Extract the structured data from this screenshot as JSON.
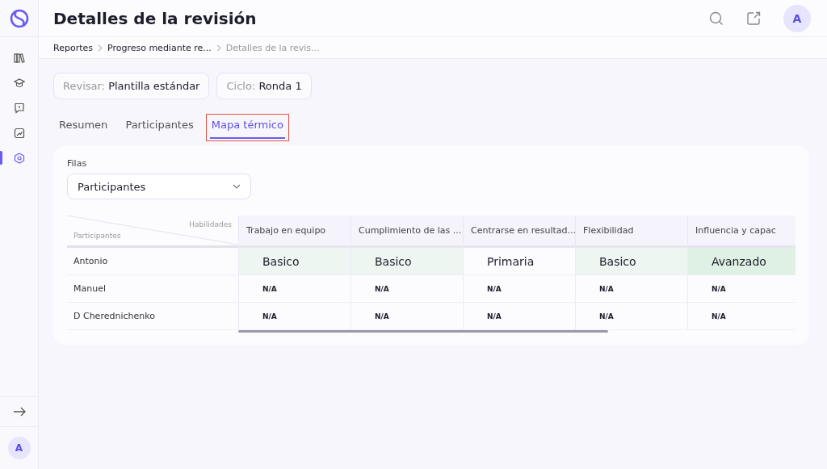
{
  "sidebar": {
    "items": [
      {
        "selected": false
      },
      {
        "selected": false
      },
      {
        "selected": false
      },
      {
        "selected": false
      },
      {
        "selected": true
      }
    ],
    "user_avatar": "A"
  },
  "header": {
    "title": "Detalles de la revisión",
    "avatar": "A"
  },
  "breadcrumb": [
    {
      "label": "Reportes",
      "current": false
    },
    {
      "label": "Progreso mediante re...",
      "current": false
    },
    {
      "label": "Detalles de la revis...",
      "current": true
    }
  ],
  "filters": [
    {
      "label": "Revisar:",
      "value": "Plantilla estándar"
    },
    {
      "label": "Ciclo:",
      "value": "Ronda 1"
    }
  ],
  "tabs": [
    {
      "label": "Resumen",
      "selected": false,
      "highlighted": false
    },
    {
      "label": "Participantes",
      "selected": false,
      "highlighted": false
    },
    {
      "label": "Mapa térmico",
      "selected": true,
      "highlighted": true
    }
  ],
  "rows_select": {
    "label": "Filas",
    "value": "Participantes"
  },
  "table": {
    "corner_top": "Habilidades",
    "corner_bottom": "Participantes",
    "columns": [
      "Trabajo en equipo",
      "Cumplimiento de las ...",
      "Centrarse en resultad...",
      "Flexibilidad",
      "Influencia y capac"
    ],
    "rows": [
      {
        "name": "Antonio",
        "cells": [
          {
            "kind": "level",
            "text": "Basico",
            "color": "#edf6f1"
          },
          {
            "kind": "level",
            "text": "Basico",
            "color": "#edf6f1"
          },
          {
            "kind": "level",
            "text": "Primaria"
          },
          {
            "kind": "level",
            "text": "Basico",
            "color": "#edf6f1"
          },
          {
            "kind": "level",
            "text": "Avanzado",
            "color": "#dff0e4"
          }
        ]
      },
      {
        "name": "Manuel",
        "cells": [
          {
            "kind": "na",
            "text": "N/A"
          },
          {
            "kind": "na",
            "text": "N/A"
          },
          {
            "kind": "na",
            "text": "N/A"
          },
          {
            "kind": "na",
            "text": "N/A"
          },
          {
            "kind": "na",
            "text": "N/A"
          }
        ]
      },
      {
        "name": "D Cherednichenko",
        "cells": [
          {
            "kind": "na",
            "text": "N/A"
          },
          {
            "kind": "na",
            "text": "N/A"
          },
          {
            "kind": "na",
            "text": "N/A"
          },
          {
            "kind": "na",
            "text": "N/A"
          },
          {
            "kind": "na",
            "text": "N/A"
          }
        ]
      }
    ]
  }
}
